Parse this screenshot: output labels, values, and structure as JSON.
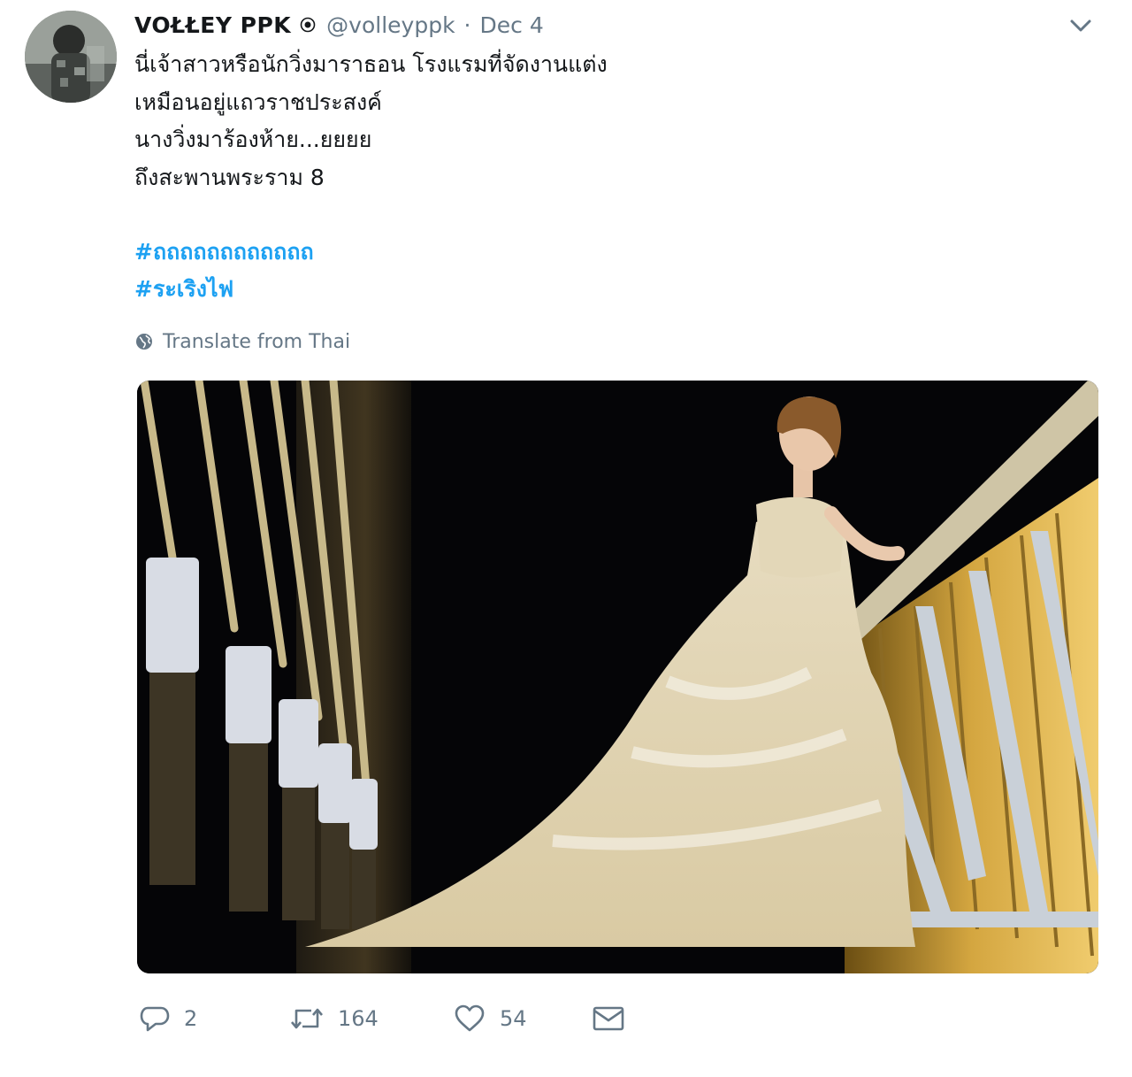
{
  "tweet": {
    "display_name": "VOŁŁEY PPK",
    "handle": "@volleyppk",
    "separator": "·",
    "date": "Dec 4",
    "text_lines": [
      "นี่เจ้าสาวหรือนักวิ่งมาราธอน โรงแรมที่จัดงานแต่ง",
      "เหมือนอยู่แถวราชประสงค์",
      "นางวิ่งมาร้องห้าย...ยยยย",
      "ถึงสะพานพระราม 8"
    ],
    "hashtags": [
      "#ถถถถถถถถถถถถ",
      "#ระเริงไฟ"
    ],
    "translate_label": "Translate from Thai",
    "media_icon": "photo-bride-on-bridge",
    "actions": {
      "reply_count": "2",
      "retweet_count": "164",
      "like_count": "54"
    },
    "icons": {
      "verified": "verified-badge-icon",
      "caret": "chevron-down-icon",
      "translate": "globe-icon",
      "reply": "reply-icon",
      "retweet": "retweet-icon",
      "like": "heart-icon",
      "dm": "envelope-icon"
    },
    "colors": {
      "text": "#14171a",
      "muted": "#657786",
      "link": "#1da1f2"
    }
  }
}
